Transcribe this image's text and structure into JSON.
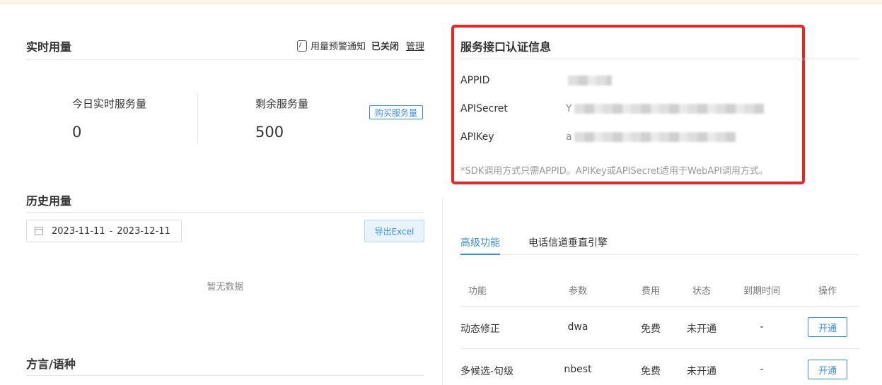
{
  "realtime": {
    "title": "实时用量",
    "alert_label": "用量预警通知",
    "alert_status": "已关闭",
    "manage_label": "管理",
    "today_label": "今日实时服务量",
    "today_value": "0",
    "remaining_label": "剩余服务量",
    "remaining_value": "500",
    "buy_label": "购买服务量"
  },
  "history": {
    "title": "历史用量",
    "date_start": "2023-11-11",
    "date_sep": "-",
    "date_end": "2023-12-11",
    "export_label": "导出Excel",
    "empty_text": "暂无数据"
  },
  "dialect": {
    "title": "方言/语种"
  },
  "credentials": {
    "title": "服务接口认证信息",
    "appid_label": "APPID",
    "apisecret_label": "APISecret",
    "apisecret_prefix": "Y",
    "apikey_label": "APIKey",
    "apikey_prefix": "a",
    "note": "*SDK调用方式只需APPID。APIKey或APISecret适用于WebAPI调用方式。"
  },
  "tabs": [
    {
      "label": "高级功能",
      "active": true
    },
    {
      "label": "电话信道垂直引擎",
      "active": false
    }
  ],
  "table": {
    "headers": [
      "功能",
      "参数",
      "费用",
      "状态",
      "到期时间",
      "操作"
    ],
    "rows": [
      {
        "feature": "动态修正",
        "param": "dwa",
        "fee": "免费",
        "status": "未开通",
        "expiry": "-",
        "action": "开通"
      },
      {
        "feature": "多候选-句级",
        "param": "nbest",
        "fee": "免费",
        "status": "未开通",
        "expiry": "-",
        "action": "开通"
      }
    ]
  },
  "colors": {
    "accent": "#3a8ee6",
    "highlight_border": "#ea2525"
  },
  "icons": {
    "alert": "alert-bell-icon",
    "calendar": "calendar-icon"
  }
}
